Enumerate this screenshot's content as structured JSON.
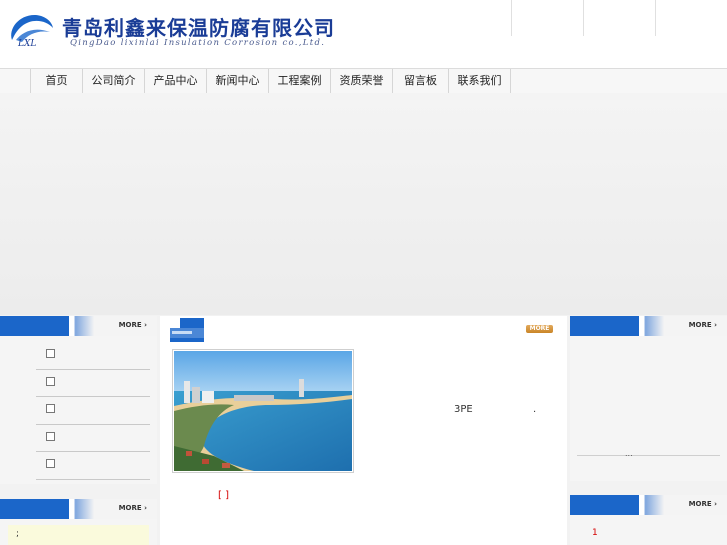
{
  "header": {
    "company_name": "青岛利鑫来保温防腐有限公司",
    "company_en": "QingDao lixinlai Insulation Corrosion co.,Ltd.",
    "logo_text": "LXL",
    "colors": {
      "brand": "#1a3c96",
      "accent": "#1b66c9"
    }
  },
  "nav": {
    "items": [
      {
        "label": "首页"
      },
      {
        "label": "公司简介"
      },
      {
        "label": "产品中心"
      },
      {
        "label": "新闻中心"
      },
      {
        "label": "工程案例"
      },
      {
        "label": "资质荣誉"
      },
      {
        "label": "留言板"
      },
      {
        "label": "联系我们"
      }
    ]
  },
  "left_panel": {
    "more_label": "MORE",
    "items": [
      {
        "label": ""
      },
      {
        "label": ""
      },
      {
        "label": ""
      },
      {
        "label": ""
      },
      {
        "label": ""
      }
    ]
  },
  "left_panel2": {
    "more_label": "MORE",
    "notice_text": ";"
  },
  "center": {
    "more_label": "MORE",
    "photo_icon": "beach-city-photo",
    "description_text": "3PE",
    "description_tail": ".",
    "detail_link": "[  ]"
  },
  "right_panel": {
    "more_label": "MORE",
    "ellipsis": "..."
  },
  "right_panel2": {
    "more_label": "MORE",
    "number": "1"
  }
}
